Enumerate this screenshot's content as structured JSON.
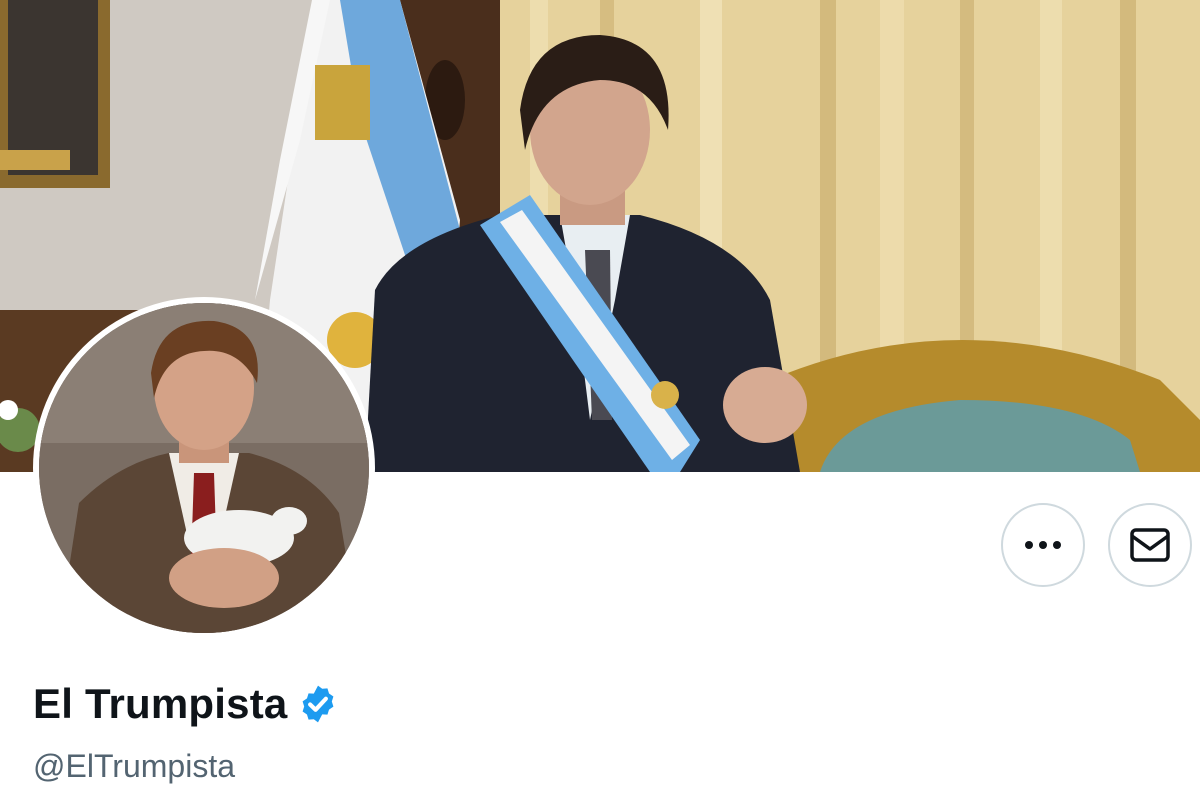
{
  "profile": {
    "display_name": "El Trumpista",
    "handle": "@ElTrumpista",
    "verified": true
  },
  "actions": {
    "more_icon": "more-horizontal-icon",
    "message_icon": "envelope-icon"
  },
  "colors": {
    "verified_blue": "#1d9bf0",
    "name_text": "#0f1419",
    "handle_text": "#536471",
    "button_border": "#cfd9de"
  }
}
